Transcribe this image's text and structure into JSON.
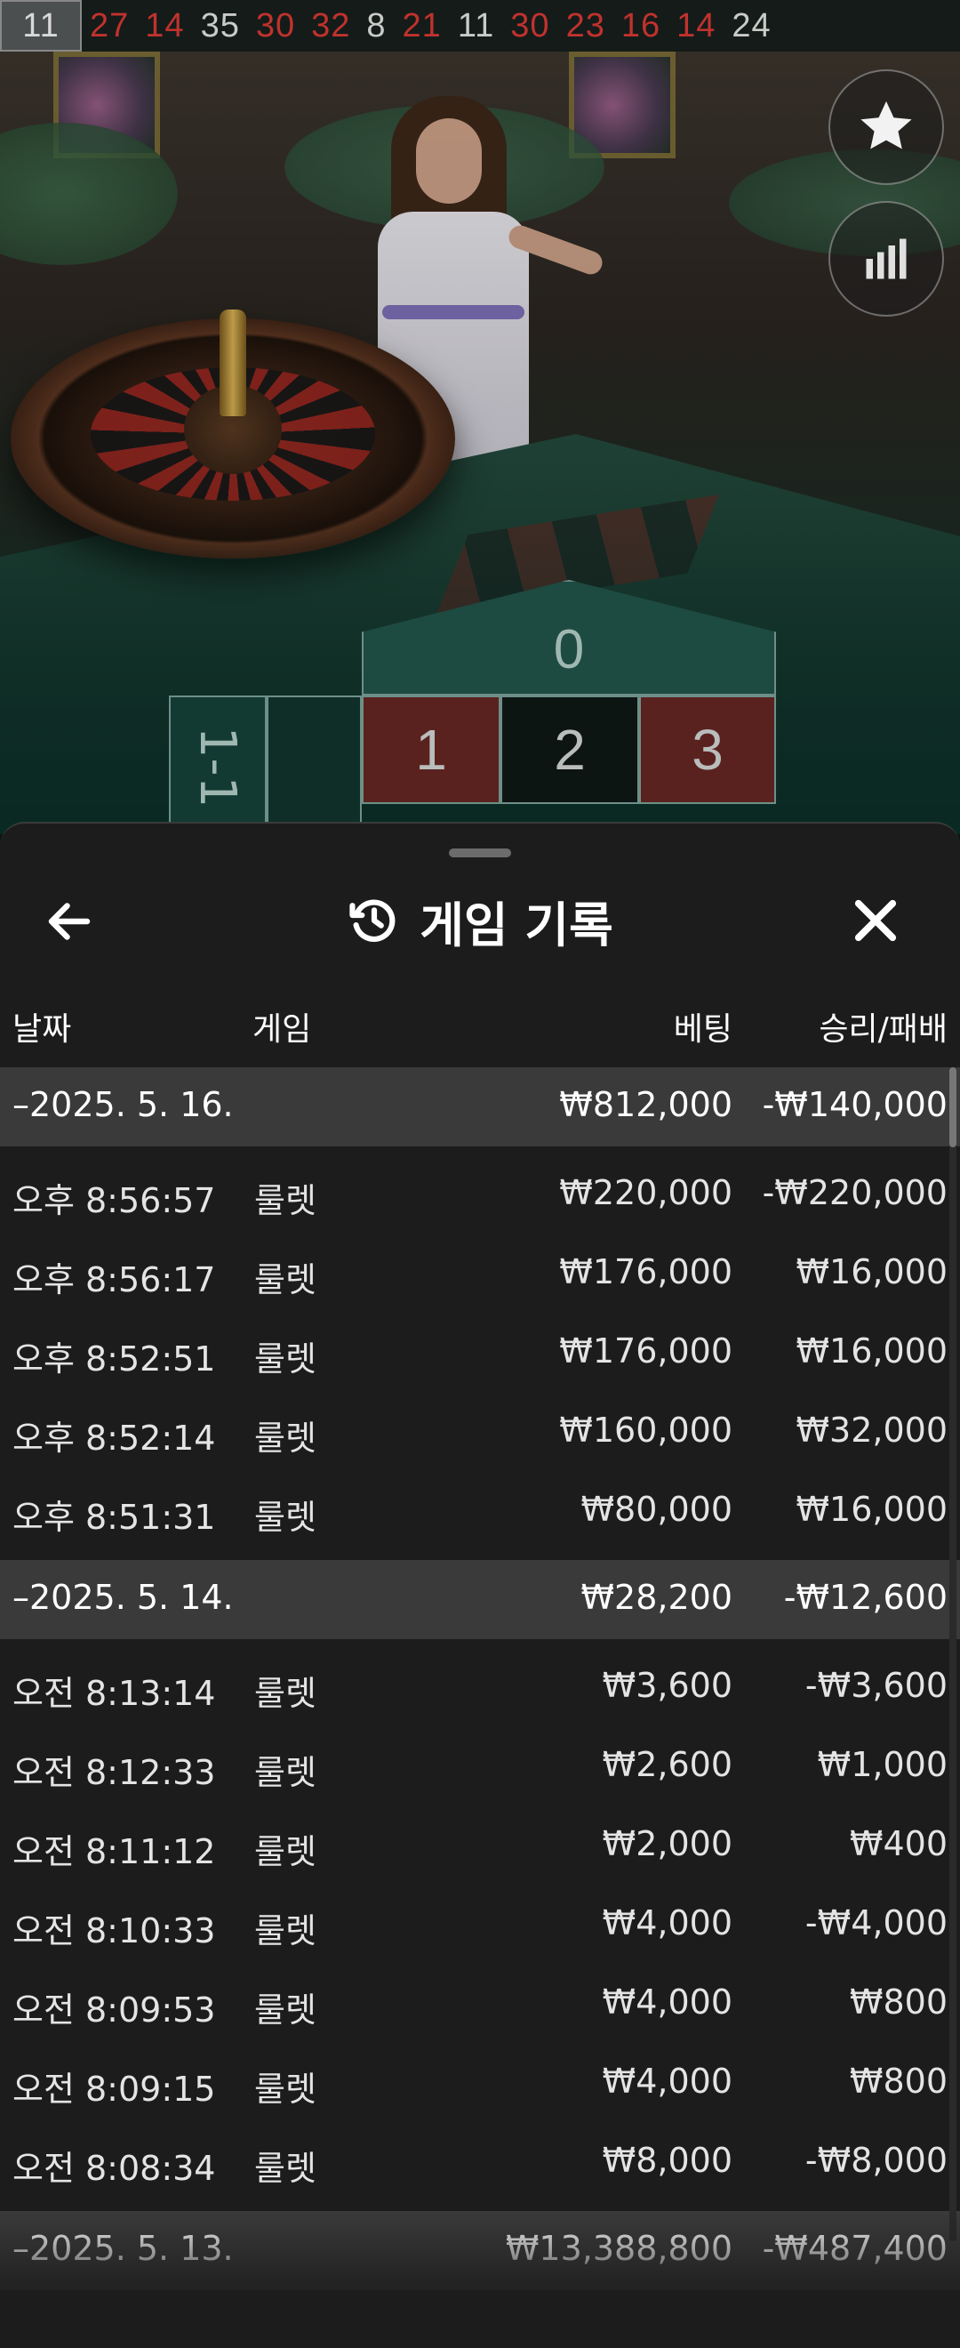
{
  "recent_results": [
    {
      "value": "11",
      "color": "black",
      "current": true
    },
    {
      "value": "27",
      "color": "red"
    },
    {
      "value": "14",
      "color": "red"
    },
    {
      "value": "35",
      "color": "black"
    },
    {
      "value": "30",
      "color": "red"
    },
    {
      "value": "32",
      "color": "red"
    },
    {
      "value": "8",
      "color": "black"
    },
    {
      "value": "21",
      "color": "red"
    },
    {
      "value": "11",
      "color": "black"
    },
    {
      "value": "30",
      "color": "red"
    },
    {
      "value": "23",
      "color": "red"
    },
    {
      "value": "16",
      "color": "red"
    },
    {
      "value": "14",
      "color": "red"
    },
    {
      "value": "24",
      "color": "black"
    }
  ],
  "side_buttons": {
    "favorite_icon": "star-icon",
    "stats_icon": "bar-chart-icon"
  },
  "bet_grid": {
    "zero": "0",
    "numbers": [
      "1",
      "2",
      "3"
    ],
    "column_label": "1-1"
  },
  "panel": {
    "title": "게임 기록",
    "title_icon": "history-icon",
    "back_icon": "arrow-left-icon",
    "close_icon": "close-icon"
  },
  "columns": {
    "date": "날짜",
    "game": "게임",
    "bet": "베팅",
    "result": "승리/패배"
  },
  "groups": [
    {
      "date": "–2025. 5. 16.",
      "bet": "₩812,000",
      "result": "-₩140,000",
      "rows": [
        {
          "time": "오후 8:56:57",
          "game": "룰렛",
          "bet": "₩220,000",
          "result": "-₩220,000"
        },
        {
          "time": "오후 8:56:17",
          "game": "룰렛",
          "bet": "₩176,000",
          "result": "₩16,000"
        },
        {
          "time": "오후 8:52:51",
          "game": "룰렛",
          "bet": "₩176,000",
          "result": "₩16,000"
        },
        {
          "time": "오후 8:52:14",
          "game": "룰렛",
          "bet": "₩160,000",
          "result": "₩32,000"
        },
        {
          "time": "오후 8:51:31",
          "game": "룰렛",
          "bet": "₩80,000",
          "result": "₩16,000"
        }
      ]
    },
    {
      "date": "–2025. 5. 14.",
      "bet": "₩28,200",
      "result": "-₩12,600",
      "rows": [
        {
          "time": "오전 8:13:14",
          "game": "룰렛",
          "bet": "₩3,600",
          "result": "-₩3,600"
        },
        {
          "time": "오전 8:12:33",
          "game": "룰렛",
          "bet": "₩2,600",
          "result": "₩1,000"
        },
        {
          "time": "오전 8:11:12",
          "game": "룰렛",
          "bet": "₩2,000",
          "result": "₩400"
        },
        {
          "time": "오전 8:10:33",
          "game": "룰렛",
          "bet": "₩4,000",
          "result": "-₩4,000"
        },
        {
          "time": "오전 8:09:53",
          "game": "룰렛",
          "bet": "₩4,000",
          "result": "₩800"
        },
        {
          "time": "오전 8:09:15",
          "game": "룰렛",
          "bet": "₩4,000",
          "result": "₩800"
        },
        {
          "time": "오전 8:08:34",
          "game": "룰렛",
          "bet": "₩8,000",
          "result": "-₩8,000"
        }
      ]
    },
    {
      "date": "–2025. 5. 13.",
      "bet": "₩13,388,800",
      "result": "-₩487,400",
      "rows": []
    }
  ],
  "colors": {
    "red_number": "#c0322d",
    "black_number": "#c9cbc8",
    "panel_bg": "#1c1c1c",
    "date_row_bg": "#3a3a3a"
  }
}
